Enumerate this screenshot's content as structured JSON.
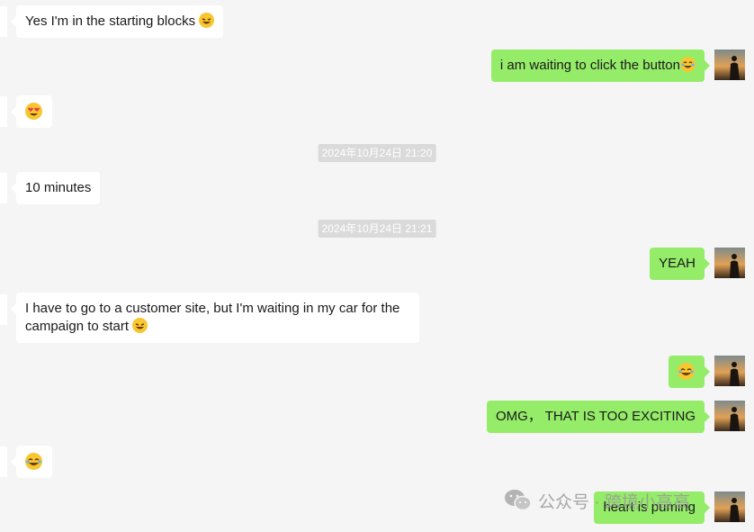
{
  "messages": [
    {
      "side": "in",
      "text": "Yes I'm in the starting blocks",
      "emoji": "rofl"
    },
    {
      "side": "out",
      "text": "i am waiting to click the button",
      "emoji": "joy"
    },
    {
      "side": "in",
      "text": "",
      "emoji": "heart-eyes"
    },
    {
      "type": "timestamp",
      "text": "2024年10月24日 21:20"
    },
    {
      "side": "in",
      "text": "10 minutes"
    },
    {
      "type": "timestamp",
      "text": "2024年10月24日 21:21"
    },
    {
      "side": "out",
      "text": "YEAH"
    },
    {
      "side": "in",
      "text_line1": "I have to go to a customer site, but I'm waiting in my car for the",
      "text_line2": "campaign to start",
      "emoji": "rofl"
    },
    {
      "side": "out",
      "text": "",
      "emoji": "joy"
    },
    {
      "side": "out",
      "text": "OMG， THAT IS TOO EXCITING"
    },
    {
      "side": "in",
      "text": "",
      "emoji": "joy"
    },
    {
      "side": "out",
      "text": "heart is puming"
    }
  ],
  "watermark": {
    "text": "公众号 · 跨境小高高",
    "icon": "wechat-icon"
  },
  "colors": {
    "background": "#f5f5f5",
    "outgoing": "#95ec69",
    "incoming": "#ffffff",
    "timestamp_bg": "#dadada"
  }
}
